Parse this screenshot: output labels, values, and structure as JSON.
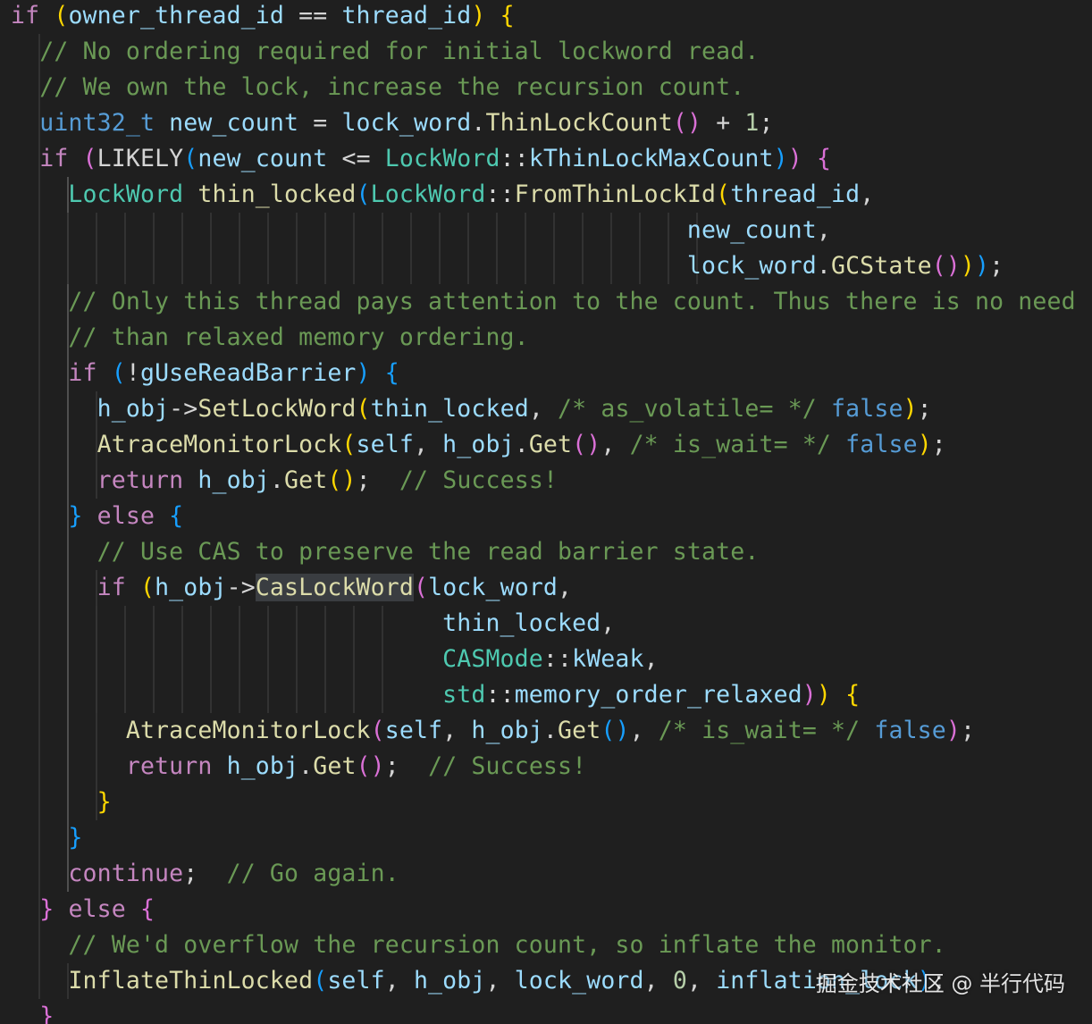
{
  "theme": {
    "background": "#1f1f1f",
    "colors": {
      "keyword": "#569cd6",
      "control": "#c586c0",
      "variable": "#9cdcfe",
      "function": "#dcdcaa",
      "type": "#4ec9b0",
      "number": "#b5cea8",
      "comment": "#6a9955",
      "bracket_level1": "#ffd700",
      "bracket_level2": "#da70d6",
      "bracket_level3": "#179fff"
    }
  },
  "code_lines": [
    [
      [
        "if",
        "ctl"
      ],
      [
        " ",
        "op"
      ],
      [
        "(",
        "b1"
      ],
      [
        "owner_thread_id",
        "var"
      ],
      [
        " == ",
        "op"
      ],
      [
        "thread_id",
        "var"
      ],
      [
        ")",
        "b1"
      ],
      [
        " ",
        "op"
      ],
      [
        "{",
        "b1"
      ]
    ],
    [
      [
        "  // No ordering required for initial lockword read.",
        "com"
      ]
    ],
    [
      [
        "  // We own the lock, increase the recursion count.",
        "com"
      ]
    ],
    [
      [
        "  ",
        "op"
      ],
      [
        "uint32_t",
        "kw"
      ],
      [
        " ",
        "op"
      ],
      [
        "new_count",
        "var"
      ],
      [
        " = ",
        "op"
      ],
      [
        "lock_word",
        "var"
      ],
      [
        ".",
        "op"
      ],
      [
        "ThinLockCount",
        "fn"
      ],
      [
        "()",
        "b2"
      ],
      [
        " + ",
        "op"
      ],
      [
        "1",
        "num"
      ],
      [
        ";",
        "op"
      ]
    ],
    [
      [
        "  ",
        "op"
      ],
      [
        "if",
        "ctl"
      ],
      [
        " ",
        "op"
      ],
      [
        "(",
        "b2"
      ],
      [
        "LIKELY",
        "op"
      ],
      [
        "(",
        "b3"
      ],
      [
        "new_count",
        "var"
      ],
      [
        " <= ",
        "op"
      ],
      [
        "LockWord",
        "type"
      ],
      [
        "::",
        "op"
      ],
      [
        "kThinLockMaxCount",
        "var"
      ],
      [
        ")",
        "b3"
      ],
      [
        ")",
        "b2"
      ],
      [
        " ",
        "op"
      ],
      [
        "{",
        "b2"
      ]
    ],
    [
      [
        "    ",
        "op"
      ],
      [
        "LockWord",
        "type"
      ],
      [
        " ",
        "op"
      ],
      [
        "thin_locked",
        "fn"
      ],
      [
        "(",
        "b3"
      ],
      [
        "LockWord",
        "type"
      ],
      [
        "::",
        "op"
      ],
      [
        "FromThinLockId",
        "fn"
      ],
      [
        "(",
        "b1"
      ],
      [
        "thread_id",
        "var"
      ],
      [
        ",",
        "op"
      ]
    ],
    [
      [
        "                                               ",
        "op"
      ],
      [
        "new_count",
        "var"
      ],
      [
        ",",
        "op"
      ]
    ],
    [
      [
        "                                               ",
        "op"
      ],
      [
        "lock_word",
        "var"
      ],
      [
        ".",
        "op"
      ],
      [
        "GCState",
        "fn"
      ],
      [
        "()",
        "b2"
      ],
      [
        ")",
        "b1"
      ],
      [
        ")",
        "b3"
      ],
      [
        ";",
        "op"
      ]
    ],
    [
      [
        "    // Only this thread pays attention to the count. Thus there is no need for stronger",
        "com"
      ]
    ],
    [
      [
        "    // than relaxed memory ordering.",
        "com"
      ]
    ],
    [
      [
        "    ",
        "op"
      ],
      [
        "if",
        "ctl"
      ],
      [
        " ",
        "op"
      ],
      [
        "(",
        "b3"
      ],
      [
        "!",
        "op"
      ],
      [
        "gUseReadBarrier",
        "var"
      ],
      [
        ")",
        "b3"
      ],
      [
        " ",
        "op"
      ],
      [
        "{",
        "b3"
      ]
    ],
    [
      [
        "      ",
        "op"
      ],
      [
        "h_obj",
        "var"
      ],
      [
        "->",
        "op"
      ],
      [
        "SetLockWord",
        "fn"
      ],
      [
        "(",
        "b1"
      ],
      [
        "thin_locked",
        "var"
      ],
      [
        ", ",
        "op"
      ],
      [
        "/* as_volatile= */",
        "com"
      ],
      [
        " ",
        "op"
      ],
      [
        "false",
        "kw"
      ],
      [
        ")",
        "b1"
      ],
      [
        ";",
        "op"
      ]
    ],
    [
      [
        "      ",
        "op"
      ],
      [
        "AtraceMonitorLock",
        "fn"
      ],
      [
        "(",
        "b1"
      ],
      [
        "self",
        "var"
      ],
      [
        ", ",
        "op"
      ],
      [
        "h_obj",
        "var"
      ],
      [
        ".",
        "op"
      ],
      [
        "Get",
        "fn"
      ],
      [
        "()",
        "b2"
      ],
      [
        ", ",
        "op"
      ],
      [
        "/* is_wait= */",
        "com"
      ],
      [
        " ",
        "op"
      ],
      [
        "false",
        "kw"
      ],
      [
        ")",
        "b1"
      ],
      [
        ";",
        "op"
      ]
    ],
    [
      [
        "      ",
        "op"
      ],
      [
        "return",
        "ctl"
      ],
      [
        " ",
        "op"
      ],
      [
        "h_obj",
        "var"
      ],
      [
        ".",
        "op"
      ],
      [
        "Get",
        "fn"
      ],
      [
        "()",
        "b1"
      ],
      [
        ";",
        "op"
      ],
      [
        "  // Success!",
        "com"
      ]
    ],
    [
      [
        "    ",
        "op"
      ],
      [
        "}",
        "b3"
      ],
      [
        " ",
        "op"
      ],
      [
        "else",
        "ctl"
      ],
      [
        " ",
        "op"
      ],
      [
        "{",
        "b3"
      ]
    ],
    [
      [
        "      // Use CAS to preserve the read barrier state.",
        "com"
      ]
    ],
    [
      [
        "      ",
        "op"
      ],
      [
        "if",
        "ctl"
      ],
      [
        " ",
        "op"
      ],
      [
        "(",
        "b1"
      ],
      [
        "h_obj",
        "var"
      ],
      [
        "->",
        "op"
      ],
      [
        "CasLockWord",
        "fn-hl"
      ],
      [
        "(",
        "b2"
      ],
      [
        "lock_word",
        "var"
      ],
      [
        ",",
        "op"
      ]
    ],
    [
      [
        "                              ",
        "op"
      ],
      [
        "thin_locked",
        "var"
      ],
      [
        ",",
        "op"
      ]
    ],
    [
      [
        "                              ",
        "op"
      ],
      [
        "CASMode",
        "type"
      ],
      [
        "::",
        "op"
      ],
      [
        "kWeak",
        "var"
      ],
      [
        ",",
        "op"
      ]
    ],
    [
      [
        "                              ",
        "op"
      ],
      [
        "std",
        "type"
      ],
      [
        "::",
        "op"
      ],
      [
        "memory_order_relaxed",
        "var"
      ],
      [
        ")",
        "b2"
      ],
      [
        ")",
        "b1"
      ],
      [
        " ",
        "op"
      ],
      [
        "{",
        "b1"
      ]
    ],
    [
      [
        "        ",
        "op"
      ],
      [
        "AtraceMonitorLock",
        "fn"
      ],
      [
        "(",
        "b2"
      ],
      [
        "self",
        "var"
      ],
      [
        ", ",
        "op"
      ],
      [
        "h_obj",
        "var"
      ],
      [
        ".",
        "op"
      ],
      [
        "Get",
        "fn"
      ],
      [
        "()",
        "b3"
      ],
      [
        ", ",
        "op"
      ],
      [
        "/* is_wait= */",
        "com"
      ],
      [
        " ",
        "op"
      ],
      [
        "false",
        "kw"
      ],
      [
        ")",
        "b2"
      ],
      [
        ";",
        "op"
      ]
    ],
    [
      [
        "        ",
        "op"
      ],
      [
        "return",
        "ctl"
      ],
      [
        " ",
        "op"
      ],
      [
        "h_obj",
        "var"
      ],
      [
        ".",
        "op"
      ],
      [
        "Get",
        "fn"
      ],
      [
        "()",
        "b2"
      ],
      [
        ";",
        "op"
      ],
      [
        "  // Success!",
        "com"
      ]
    ],
    [
      [
        "      ",
        "op"
      ],
      [
        "}",
        "b1"
      ]
    ],
    [
      [
        "    ",
        "op"
      ],
      [
        "}",
        "b3"
      ]
    ],
    [
      [
        "    ",
        "op"
      ],
      [
        "continue",
        "ctl"
      ],
      [
        ";",
        "op"
      ],
      [
        "  // Go again.",
        "com"
      ]
    ],
    [
      [
        "  ",
        "op"
      ],
      [
        "}",
        "b2"
      ],
      [
        " ",
        "op"
      ],
      [
        "else",
        "ctl"
      ],
      [
        " ",
        "op"
      ],
      [
        "{",
        "b2"
      ]
    ],
    [
      [
        "    // We'd overflow the recursion count, so inflate the monitor.",
        "com"
      ]
    ],
    [
      [
        "    ",
        "op"
      ],
      [
        "InflateThinLocked",
        "fn"
      ],
      [
        "(",
        "b3"
      ],
      [
        "self",
        "var"
      ],
      [
        ", ",
        "op"
      ],
      [
        "h_obj",
        "var"
      ],
      [
        ", ",
        "op"
      ],
      [
        "lock_word",
        "var"
      ],
      [
        ", ",
        "op"
      ],
      [
        "0",
        "num"
      ],
      [
        ", ",
        "op"
      ],
      [
        "inflation_lock",
        "var"
      ],
      [
        ")",
        "b3"
      ],
      [
        ";",
        "op"
      ]
    ],
    [
      [
        "  ",
        "op"
      ],
      [
        "}",
        "b2"
      ]
    ]
  ],
  "watermark": "掘金技术社区 @ 半行代码"
}
